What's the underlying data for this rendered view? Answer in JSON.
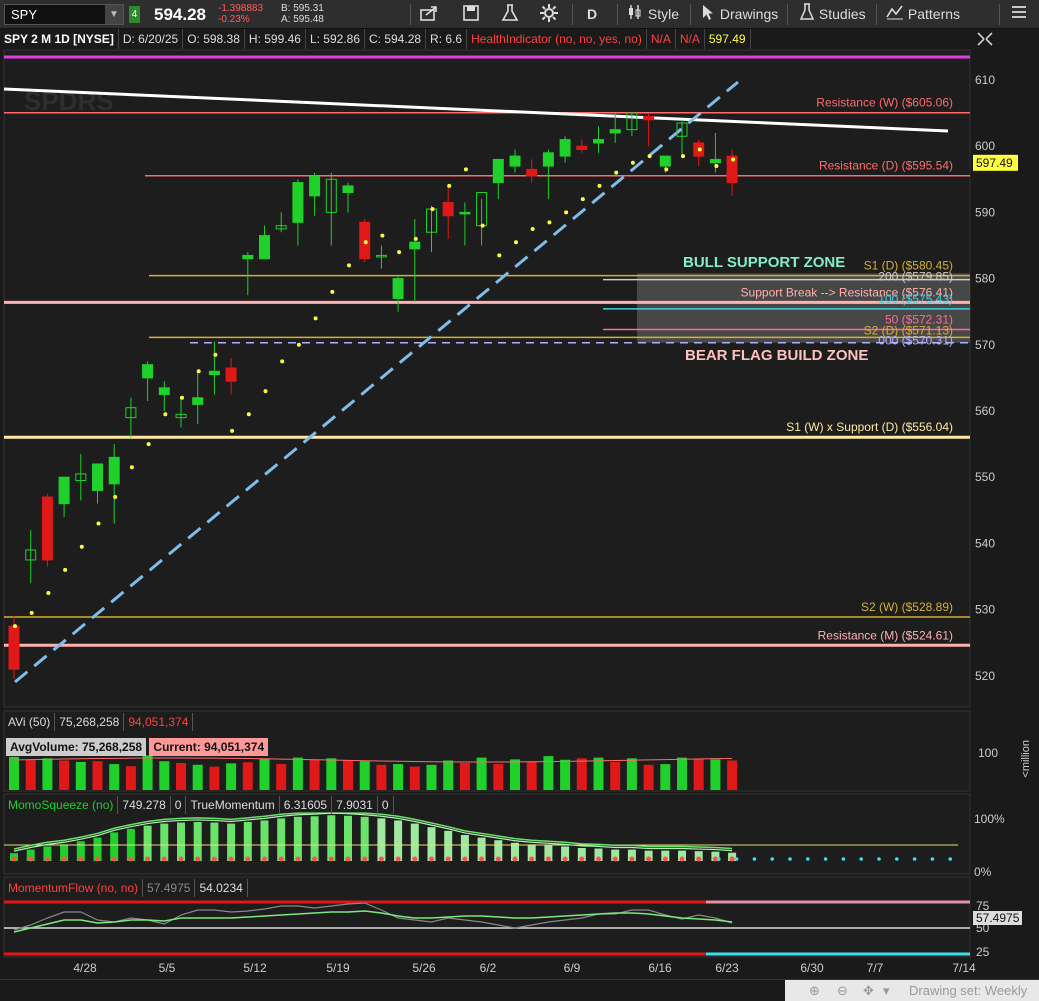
{
  "toolbar": {
    "symbol": "SPY",
    "last_price": "594.28",
    "change": "-1.398883",
    "change_pct": "-0.23%",
    "bid": "B: 595.31",
    "ask": "A: 595.48",
    "period": "D",
    "style_label": "Style",
    "drawings_label": "Drawings",
    "studies_label": "Studies",
    "patterns_label": "Patterns"
  },
  "infobar": {
    "title": "SPY 2 M 1D [NYSE]",
    "date": "D: 6/20/25",
    "open": "O: 598.38",
    "high": "H: 599.46",
    "low": "L: 592.86",
    "close": "C: 594.28",
    "range": "R: 6.6",
    "health": "HealthIndicator (no, no, yes, no)",
    "na1": "N/A",
    "na2": "N/A",
    "value": "597.49"
  },
  "price_axis": {
    "ticks": [
      "610",
      "600",
      "590",
      "580",
      "570",
      "560",
      "550",
      "540",
      "530",
      "520"
    ],
    "current_label": "597.49"
  },
  "levels": [
    {
      "label": "Resistance (W) ($605.06)",
      "value": 605.06,
      "color": "#ff6b6b"
    },
    {
      "label": "Resistance (D) ($595.54)",
      "value": 595.54,
      "color": "#ff6b6b"
    },
    {
      "label": "S1 (D) ($580.45)",
      "value": 580.45,
      "color": "#d4b030"
    },
    {
      "label": "200 ($579.85)",
      "value": 579.85,
      "color": "#cccccc"
    },
    {
      "label": "Support Break --> Resistance ($576.41)",
      "value": 576.41,
      "color": "#ffb0b0"
    },
    {
      "label": "100 ($575.43)",
      "value": 575.43,
      "color": "#3cd0e0"
    },
    {
      "label": "50 ($572.31)",
      "value": 572.31,
      "color": "#ff6b9b"
    },
    {
      "label": "S2 (D) ($571.13)",
      "value": 571.13,
      "color": "#d4b030"
    },
    {
      "label": "000 ($570.31)",
      "value": 570.31,
      "color": "#b0b0ff"
    },
    {
      "label": "S1 (W) x Support (D) ($556.04)",
      "value": 556.04,
      "color": "#ffe9a0"
    },
    {
      "label": "S2 (W) ($528.89)",
      "value": 528.89,
      "color": "#d4b030"
    },
    {
      "label": "Resistance (M) ($524.61)",
      "value": 524.61,
      "color": "#ffb0b0"
    }
  ],
  "zones": {
    "bull": "BULL SUPPORT ZONE",
    "bear": "BEAR FLAG BUILD ZONE"
  },
  "candles": [
    [
      527.5,
      529.0,
      519.5,
      521.0
    ],
    [
      537.5,
      542.0,
      534.0,
      539.0
    ],
    [
      547.0,
      547.5,
      536.5,
      537.5
    ],
    [
      546.0,
      550.0,
      544.0,
      550.0
    ],
    [
      549.5,
      553.5,
      546.5,
      550.5
    ],
    [
      548.0,
      552.0,
      546.0,
      552.0
    ],
    [
      549.0,
      555.0,
      543.0,
      553.0
    ],
    [
      559.0,
      562.0,
      556.0,
      560.5
    ],
    [
      565.0,
      567.5,
      561.5,
      567.0
    ],
    [
      562.5,
      564.5,
      560.0,
      563.5
    ],
    [
      559.0,
      562.0,
      557.5,
      559.5
    ],
    [
      561.0,
      566.0,
      558.0,
      562.0
    ],
    [
      565.5,
      570.5,
      562.5,
      566.0
    ],
    [
      566.5,
      568.0,
      562.5,
      564.5
    ],
    [
      583.0,
      584.0,
      577.5,
      583.5
    ],
    [
      583.0,
      588.0,
      583.0,
      586.5
    ],
    [
      587.5,
      590.0,
      587.0,
      588.0
    ],
    [
      588.5,
      595.0,
      585.0,
      594.5
    ],
    [
      592.5,
      596.0,
      589.5,
      595.5
    ],
    [
      590.0,
      596.0,
      585.0,
      595.0
    ],
    [
      593.0,
      594.5,
      590.0,
      594.0
    ],
    [
      588.5,
      589.0,
      582.5,
      583.0
    ],
    [
      583.5,
      585.0,
      581.5,
      583.5
    ],
    [
      577.0,
      580.5,
      575.0,
      580.0
    ],
    [
      584.5,
      589.0,
      576.5,
      585.5
    ],
    [
      587.0,
      591.0,
      584.0,
      590.5
    ],
    [
      591.5,
      594.0,
      586.0,
      589.5
    ],
    [
      590.0,
      591.5,
      585.0,
      590.0
    ],
    [
      588.0,
      592.0,
      585.0,
      593.0
    ],
    [
      594.5,
      598.0,
      592.0,
      598.0
    ],
    [
      597.0,
      599.5,
      596.0,
      598.5
    ],
    [
      596.5,
      598.0,
      594.5,
      595.5
    ],
    [
      597.0,
      599.5,
      592.0,
      599.0
    ],
    [
      598.5,
      601.5,
      597.5,
      601.0
    ],
    [
      600.0,
      601.0,
      599.0,
      599.5
    ],
    [
      600.5,
      603.0,
      599.0,
      601.0
    ],
    [
      602.0,
      605.0,
      600.5,
      602.5
    ],
    [
      602.5,
      605.0,
      601.5,
      605.0
    ],
    [
      604.5,
      605.0,
      600.0,
      604.0
    ],
    [
      597.0,
      598.0,
      596.0,
      598.5
    ],
    [
      601.5,
      604.0,
      598.5,
      603.5
    ],
    [
      600.5,
      601.0,
      597.0,
      598.5
    ],
    [
      597.5,
      602.0,
      596.0,
      598.0
    ],
    [
      598.5,
      599.5,
      592.5,
      594.5
    ]
  ],
  "dots": [
    527.5,
    529.5,
    532.5,
    536.0,
    539.5,
    543.0,
    547.0,
    551.5,
    555.0,
    559.5,
    562.0,
    566.0,
    568.5,
    557.0,
    559.5,
    563.0,
    567.5,
    570.0,
    574.0,
    578.0,
    582.0,
    585.5,
    586.5,
    584.0,
    586.0,
    590.5,
    594.0,
    596.5,
    588.0,
    583.5,
    585.5,
    587.5,
    588.5,
    590.0,
    592.0,
    594.0,
    596.0,
    597.5,
    598.5,
    596.5,
    598.5,
    599.5,
    597.0,
    598.0
  ],
  "volume_panel": {
    "title": "AVi (50)",
    "v1": "75,268,258",
    "v2": "94,051,374",
    "avg_label": "AvgVolume: 75,268,258",
    "cur_label": "Current: 94,051,374",
    "axis_100": "100",
    "axis_unit": "<million",
    "bars": [
      92,
      85,
      88,
      82,
      78,
      80,
      72,
      66,
      96,
      80,
      75,
      70,
      65,
      74,
      77,
      86,
      72,
      90,
      84,
      88,
      82,
      80,
      70,
      72,
      65,
      70,
      82,
      75,
      90,
      72,
      85,
      78,
      94,
      84,
      88,
      90,
      78,
      88,
      70,
      72,
      90,
      86,
      85,
      82
    ],
    "bar_up": [
      true,
      false,
      true,
      false,
      true,
      false,
      true,
      false,
      true,
      true,
      false,
      true,
      false,
      true,
      false,
      true,
      false,
      true,
      false,
      true,
      false,
      true,
      false,
      true,
      false,
      true,
      true,
      false,
      true,
      false,
      true,
      false,
      true,
      true,
      false,
      true,
      false,
      true,
      false,
      true,
      true,
      false,
      true,
      false
    ]
  },
  "momo_panel": {
    "title": "MomoSqueeze (no)",
    "v1": "749.278",
    "v2": "0",
    "tm_title": "TrueMomentum",
    "tm1": "6.31605",
    "tm2": "7.9031",
    "tm3": "0",
    "axis_100": "100%",
    "axis_0": "0%",
    "bars": [
      15,
      22,
      28,
      32,
      38,
      45,
      55,
      62,
      68,
      72,
      74,
      75,
      74,
      72,
      75,
      78,
      82,
      85,
      86,
      88,
      87,
      85,
      82,
      78,
      72,
      65,
      58,
      50,
      45,
      40,
      35,
      32,
      30,
      28,
      25,
      24,
      22,
      22,
      20,
      20,
      20,
      19,
      18,
      16
    ]
  },
  "mflow_panel": {
    "title": "MomentumFlow (no, no)",
    "v1": "57.4975",
    "v2": "54.0234",
    "axis_75": "75",
    "axis_50": "50",
    "axis_25": "25",
    "current_label": "57.4975"
  },
  "time_axis": [
    "4/28",
    "5/5",
    "5/12",
    "5/19",
    "5/26",
    "6/2",
    "6/9",
    "6/16",
    "6/23",
    "6/30",
    "7/7",
    "7/14"
  ],
  "status": {
    "drawing_set": "Drawing set: Weekly"
  },
  "colors": {
    "up": "#1fd12a",
    "down": "#e01818",
    "dot": "#ffff3c",
    "trend_up": "#7dbde8",
    "highlight_bg": "#ff9999"
  }
}
